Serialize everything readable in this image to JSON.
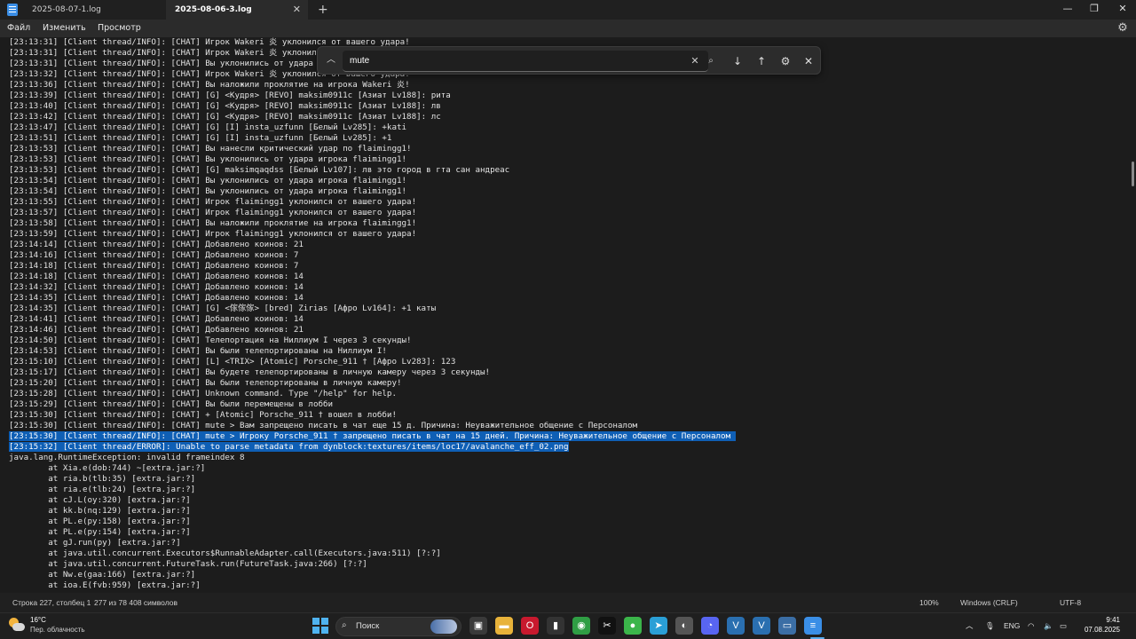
{
  "window": {
    "tabs": [
      {
        "label": "2025-08-07-1.log"
      },
      {
        "label": "2025-08-06-3.log"
      }
    ],
    "new_tab_label": "+",
    "close_tab_glyph": "✕",
    "minimize_glyph": "—",
    "maximize_glyph": "❐",
    "close_glyph": "✕"
  },
  "menu": {
    "file": "Файл",
    "edit": "Изменить",
    "view": "Просмотр",
    "settings_icon": "gear-icon"
  },
  "find": {
    "query": "mute",
    "collapse_glyph": "︿",
    "clear_glyph": "✕",
    "search_glyph": "⌕",
    "next_glyph": "↓",
    "prev_glyph": "↑",
    "options_glyph": "⚙",
    "close_glyph": "✕"
  },
  "log": {
    "selected_lines": [
      37,
      38
    ],
    "lines": [
      "[23:13:31] [Client thread/INFO]: [CHAT] Игрок Wakeri 炎 уклонился от вашего удара!",
      "[23:13:31] [Client thread/INFO]: [CHAT] Игрок Wakeri 炎 уклонился от вашего удара!",
      "[23:13:31] [Client thread/INFO]: [CHAT] Вы уклонились от удара игрока Wakeri 炎!",
      "[23:13:32] [Client thread/INFO]: [CHAT] Игрок Wakeri 炎 уклонился от вашего удара!",
      "[23:13:36] [Client thread/INFO]: [CHAT] Вы наложили проклятие на игрока Wakeri 炎!",
      "[23:13:39] [Client thread/INFO]: [CHAT] [G] <Кудря> [REVO] maksim0911c [Азиат Lv188]: рита",
      "[23:13:40] [Client thread/INFO]: [CHAT] [G] <Кудря> [REVO] maksim0911c [Азиат Lv188]: лв",
      "[23:13:42] [Client thread/INFO]: [CHAT] [G] <Кудря> [REVO] maksim0911c [Азиат Lv188]: лс",
      "[23:13:47] [Client thread/INFO]: [CHAT] [G] [I] insta_uzfunn [Белый Lv285]: +kati",
      "[23:13:51] [Client thread/INFO]: [CHAT] [G] [I] insta_uzfunn [Белый Lv285]: +1",
      "[23:13:53] [Client thread/INFO]: [CHAT] Вы нанесли критический удар по flaimingg1!",
      "[23:13:53] [Client thread/INFO]: [CHAT] Вы уклонились от удара игрока flaimingg1!",
      "[23:13:53] [Client thread/INFO]: [CHAT] [G] maksimqaqdss [Белый Lv107]: лв это город в гта сан андреас",
      "[23:13:54] [Client thread/INFO]: [CHAT] Вы уклонились от удара игрока flaimingg1!",
      "[23:13:54] [Client thread/INFO]: [CHAT] Вы уклонились от удара игрока flaimingg1!",
      "[23:13:55] [Client thread/INFO]: [CHAT] Игрок flaimingg1 уклонился от вашего удара!",
      "[23:13:57] [Client thread/INFO]: [CHAT] Игрок flaimingg1 уклонился от вашего удара!",
      "[23:13:58] [Client thread/INFO]: [CHAT] Вы наложили проклятие на игрока flaimingg1!",
      "[23:13:59] [Client thread/INFO]: [CHAT] Игрок flaimingg1 уклонился от вашего удара!",
      "[23:14:14] [Client thread/INFO]: [CHAT] Добавлено коинов: 21",
      "[23:14:16] [Client thread/INFO]: [CHAT] Добавлено коинов: 7",
      "[23:14:18] [Client thread/INFO]: [CHAT] Добавлено коинов: 7",
      "[23:14:18] [Client thread/INFO]: [CHAT] Добавлено коинов: 14",
      "[23:14:32] [Client thread/INFO]: [CHAT] Добавлено коинов: 14",
      "[23:14:35] [Client thread/INFO]: [CHAT] Добавлено коинов: 14",
      "[23:14:35] [Client thread/INFO]: [CHAT] [G] <傢傢傢> [bred] Zirias [Афро Lv164]: +1 каты",
      "[23:14:41] [Client thread/INFO]: [CHAT] Добавлено коинов: 14",
      "[23:14:46] [Client thread/INFO]: [CHAT] Добавлено коинов: 21",
      "[23:14:50] [Client thread/INFO]: [CHAT] Телепортация на Ниллиум I через 3 секунды!",
      "[23:14:53] [Client thread/INFO]: [CHAT] Вы были телепортированы на Ниллиум I!",
      "[23:15:10] [Client thread/INFO]: [CHAT] [L] <TRIX> [Atomic] Porsche_911 † [Афро Lv283]: 123",
      "[23:15:17] [Client thread/INFO]: [CHAT] Вы будете телепортированы в личную камеру через 3 секунды!",
      "[23:15:20] [Client thread/INFO]: [CHAT] Вы были телепортированы в личную камеру!",
      "[23:15:28] [Client thread/INFO]: [CHAT] Unknown command. Type \"/help\" for help.",
      "[23:15:29] [Client thread/INFO]: [CHAT] Вы были перемещены в лобби",
      "[23:15:30] [Client thread/INFO]: [CHAT] + [Atomic] Porsche_911 † вошел в лобби!",
      "[23:15:30] [Client thread/INFO]: [CHAT] mute > Вам запрещено писать в чат еще 15 д. Причина: Неуважительное общение с Персоналом",
      "[23:15:30] [Client thread/INFO]: [CHAT] mute > Игроку Porsche_911 † запрещено писать в чат на 15 дней. Причина: Неуважительное общение с Персоналом ",
      "[23:15:32] [Client thread/ERROR]: Unable to parse metadata from dynblock:textures/items/loc17/avalanche_eff_02.png",
      "java.lang.RuntimeException: invalid frameindex 8",
      "\tat Xia.e(dob:744) ~[extra.jar:?]",
      "\tat ria.b(tlb:35) [extra.jar:?]",
      "\tat ria.e(tlb:24) [extra.jar:?]",
      "\tat cJ.L(oy:320) [extra.jar:?]",
      "\tat kk.b(nq:129) [extra.jar:?]",
      "\tat PL.e(py:158) [extra.jar:?]",
      "\tat PL.e(py:154) [extra.jar:?]",
      "\tat gJ.run(py) [extra.jar:?]",
      "\tat java.util.concurrent.Executors$RunnableAdapter.call(Executors.java:511) [?:?]",
      "\tat java.util.concurrent.FutureTask.run(FutureTask.java:266) [?:?]",
      "\tat Nw.e(gaa:166) [extra.jar:?]",
      "\tat ioa.E(fvb:959) [extra.jar:?]"
    ]
  },
  "status": {
    "position": "Строка 227, столбец 1",
    "count": "277 из 78 408 символов",
    "zoom": "100%",
    "line_ending": "Windows (CRLF)",
    "encoding": "UTF-8"
  },
  "taskbar": {
    "weather_temp": "16°C",
    "weather_desc": "Пер. облачность",
    "search_label": "Поиск",
    "language": "ENG",
    "time": "9:41",
    "date": "07.08.2025",
    "apps": [
      {
        "name": "task-view-icon",
        "glyph": "▣",
        "color": "#3a3a3a"
      },
      {
        "name": "file-explorer-icon",
        "glyph": "▬",
        "color": "#e8b33a"
      },
      {
        "name": "opera-icon",
        "glyph": "O",
        "color": "#c8192e"
      },
      {
        "name": "flashlight-app-icon",
        "glyph": "▮",
        "color": "#333333"
      },
      {
        "name": "chrome-icon",
        "glyph": "◉",
        "color": "#2f9e44"
      },
      {
        "name": "capcut-icon",
        "glyph": "✂",
        "color": "#111111"
      },
      {
        "name": "green-app-icon",
        "glyph": "●",
        "color": "#3bb54a"
      },
      {
        "name": "telegram-icon",
        "glyph": "➤",
        "color": "#2a9fd6"
      },
      {
        "name": "mouse-app-icon",
        "glyph": "◐",
        "color": "#555555"
      },
      {
        "name": "discord-icon",
        "glyph": "◔",
        "color": "#5865f2"
      },
      {
        "name": "vortex-icon",
        "glyph": "V",
        "color": "#2a6fb0"
      },
      {
        "name": "vortex-2-icon",
        "glyph": "V",
        "color": "#2a6fb0"
      },
      {
        "name": "monitor-app-icon",
        "glyph": "▭",
        "color": "#3b6ea5"
      },
      {
        "name": "notepad-icon",
        "glyph": "≡",
        "color": "#3a8ee6"
      }
    ]
  }
}
